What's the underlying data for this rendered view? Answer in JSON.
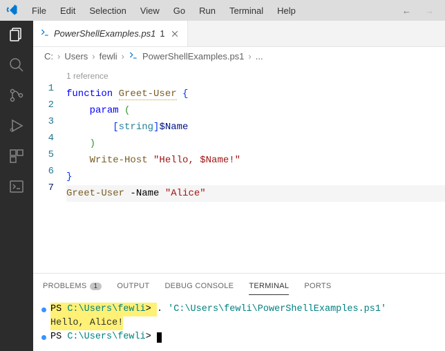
{
  "menubar": {
    "items": [
      "File",
      "Edit",
      "Selection",
      "View",
      "Go",
      "Run",
      "Terminal",
      "Help"
    ]
  },
  "tab": {
    "label": "PowerShellExamples.ps1",
    "dirty_marker": "1"
  },
  "breadcrumb": {
    "parts": [
      "C:",
      "Users",
      "fewli",
      "PowerShellExamples.ps1",
      "..."
    ]
  },
  "code": {
    "codelens": "1 reference",
    "lines": {
      "l1_kw": "function",
      "l1_fn": "Greet-User",
      "l1_brace": "{",
      "l2_kw": "param",
      "l2_paren_open": "(",
      "l3_bracket_open": "[",
      "l3_type": "string",
      "l3_bracket_close": "]",
      "l3_var": "$Name",
      "l4_paren_close": ")",
      "l5_fn": "Write-Host",
      "l5_str": "\"Hello, $Name!\"",
      "l6_brace": "}",
      "l7_fn": "Greet-User",
      "l7_param": "-Name",
      "l7_str": "\"Alice\""
    },
    "line_numbers": [
      "1",
      "2",
      "3",
      "4",
      "5",
      "6",
      "7"
    ]
  },
  "panel": {
    "tabs": {
      "problems": "PROBLEMS",
      "problems_count": "1",
      "output": "OUTPUT",
      "debug": "DEBUG CONSOLE",
      "terminal": "TERMINAL",
      "ports": "PORTS"
    }
  },
  "terminal": {
    "prompt1_ps": "PS ",
    "prompt1_path": "C:\\Users\\fewli",
    "prompt1_gt": "> ",
    "cmd1_dot": ". ",
    "cmd1_path": "'C:\\Users\\fewli\\PowerShellExamples.ps1'",
    "output1": "Hello, Alice!",
    "prompt2_ps": "PS ",
    "prompt2_path": "C:\\Users\\fewli",
    "prompt2_gt": "> "
  }
}
